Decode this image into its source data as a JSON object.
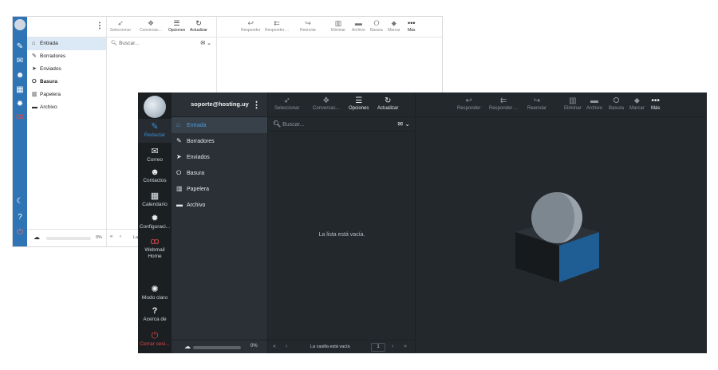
{
  "light_window": {
    "folders": [
      {
        "label": "Entrada",
        "icon": "inbox-icon",
        "selected": true
      },
      {
        "label": "Borradores",
        "icon": "pencil-icon",
        "selected": false
      },
      {
        "label": "Enviados",
        "icon": "send-icon",
        "selected": false
      },
      {
        "label": "Basura",
        "icon": "junk-icon",
        "selected": false
      },
      {
        "label": "Papelera",
        "icon": "trash-icon",
        "selected": false
      },
      {
        "label": "Archivo",
        "icon": "archive-icon",
        "selected": false
      }
    ],
    "list_toolbar": {
      "select": "Seleccionar",
      "threads": "Conversac...",
      "options": "Opciones",
      "refresh": "Actualizar"
    },
    "search_placeholder": "Buscar...",
    "preview_toolbar": {
      "reply": "Responder",
      "reply_all": "Responder ...",
      "forward": "Reenviar",
      "delete": "Eliminar",
      "archive": "Archivo",
      "junk": "Basura",
      "mark": "Marcar",
      "more": "Más"
    },
    "quota_percent": "0%",
    "pager_first": "«",
    "pager_prev": "‹",
    "pager_text": "La"
  },
  "dark_window": {
    "account": "soporte@hosting.uy",
    "rail": {
      "compose": "Redactar",
      "mail": "Correo",
      "contacts": "Contactos",
      "calendar": "Calendario",
      "settings": "Configuraci...",
      "webmail_home_1": "Webmail",
      "webmail_home_2": "Home",
      "light_mode": "Modo claro",
      "about": "Acerca de",
      "logout": "Cerrar sesi..."
    },
    "folders": [
      {
        "label": "Entrada",
        "icon": "inbox-icon",
        "selected": true
      },
      {
        "label": "Borradores",
        "icon": "pencil-icon",
        "selected": false
      },
      {
        "label": "Enviados",
        "icon": "send-icon",
        "selected": false
      },
      {
        "label": "Basura",
        "icon": "junk-icon",
        "selected": false
      },
      {
        "label": "Papelera",
        "icon": "trash-icon",
        "selected": false
      },
      {
        "label": "Archivo",
        "icon": "archive-icon",
        "selected": false
      }
    ],
    "list_toolbar": {
      "select": "Seleccionar",
      "threads": "Conversac...",
      "options": "Opciones",
      "refresh": "Actualizar"
    },
    "search_placeholder": "Buscar...",
    "empty_message": "La lista está vacía.",
    "preview_toolbar": {
      "reply": "Responder",
      "reply_all": "Responder ...",
      "forward": "Reenviar",
      "delete": "Eliminar",
      "archive": "Archivo",
      "junk": "Basura",
      "mark": "Marcar",
      "more": "Más"
    },
    "quota_percent": "0%",
    "pager": {
      "first": "«",
      "prev": "‹",
      "status": "La casilla está vacía",
      "page": "1",
      "next": "›",
      "last": "»"
    }
  },
  "colors": {
    "accent_blue": "#3b8fd6",
    "light_rail": "#2f75b5",
    "dark_bg": "#23282c",
    "logout_red": "#e04545"
  }
}
